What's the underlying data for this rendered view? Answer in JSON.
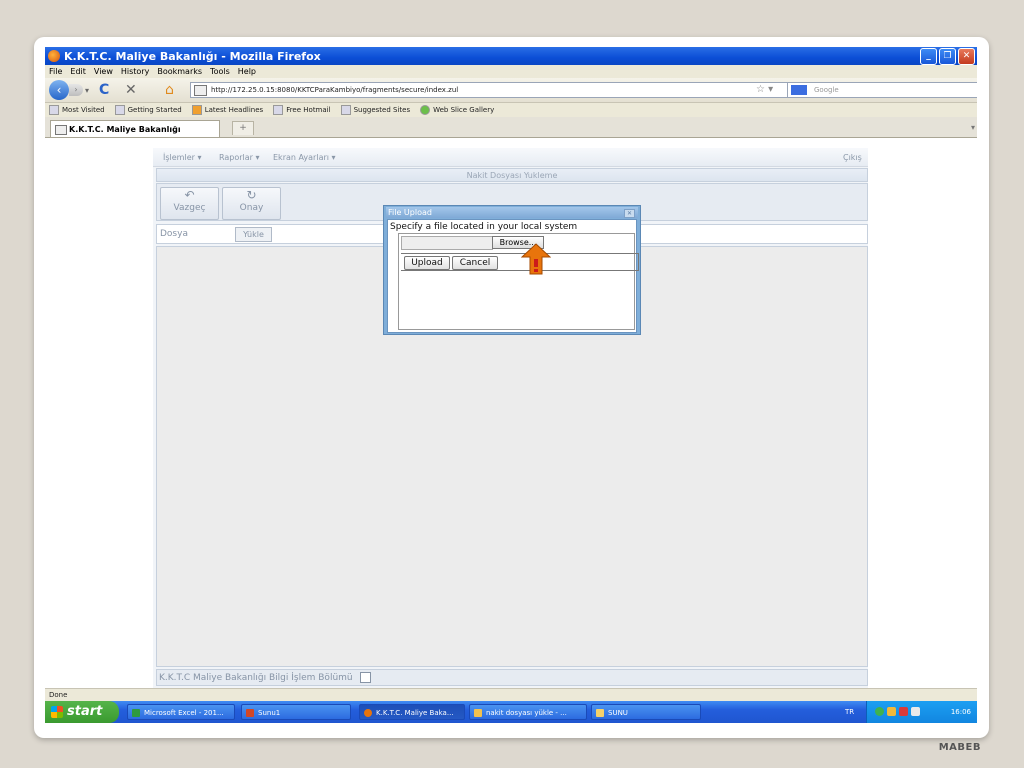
{
  "window": {
    "title": "K.K.T.C. Maliye Bakanlığı - Mozilla Firefox"
  },
  "menubar": [
    "File",
    "Edit",
    "View",
    "History",
    "Bookmarks",
    "Tools",
    "Help"
  ],
  "navbar": {
    "url": "http://172.25.0.15:8080/KKTCParaKambiyo/fragments/secure/index.zul",
    "search_placeholder": "Google"
  },
  "bookmarks": [
    "Most Visited",
    "Getting Started",
    "Latest Headlines",
    "Free Hotmail",
    "Suggested Sites",
    "Web Slice Gallery"
  ],
  "tab": {
    "title": "K.K.T.C. Maliye Bakanlığı",
    "new_tab": "+"
  },
  "app": {
    "menu": {
      "islemler": "İşlemler ▾",
      "raporlar": "Raporlar ▾",
      "ekran": "Ekran Ayarları ▾",
      "cikis": "Çıkış"
    },
    "panel_title": "Nakit Dosyası Yukleme",
    "toolbar": {
      "vazgec": "Vazgeç",
      "onay": "Onay"
    },
    "file_label": "Dosya",
    "upload_button": "Yükle",
    "footer": "K.K.T.C Maliye Bakanlığı Bilgi İşlem Bölümü"
  },
  "dialog": {
    "title": "File Upload",
    "prompt": "Specify a file located in your local system",
    "browse": "Browse...",
    "upload": "Upload",
    "cancel": "Cancel"
  },
  "status": "Done",
  "taskbar": {
    "start": "start",
    "tasks": [
      "Microsoft Excel - 201...",
      "Sunu1",
      "K.K.T.C. Maliye Baka...",
      "nakit dosyası yükle - ...",
      "SUNU"
    ],
    "lang": "TR",
    "clock": "16:06"
  },
  "brand": "MABEB",
  "colors": {
    "accent": "#245edc",
    "arrow": "#e8740c"
  }
}
